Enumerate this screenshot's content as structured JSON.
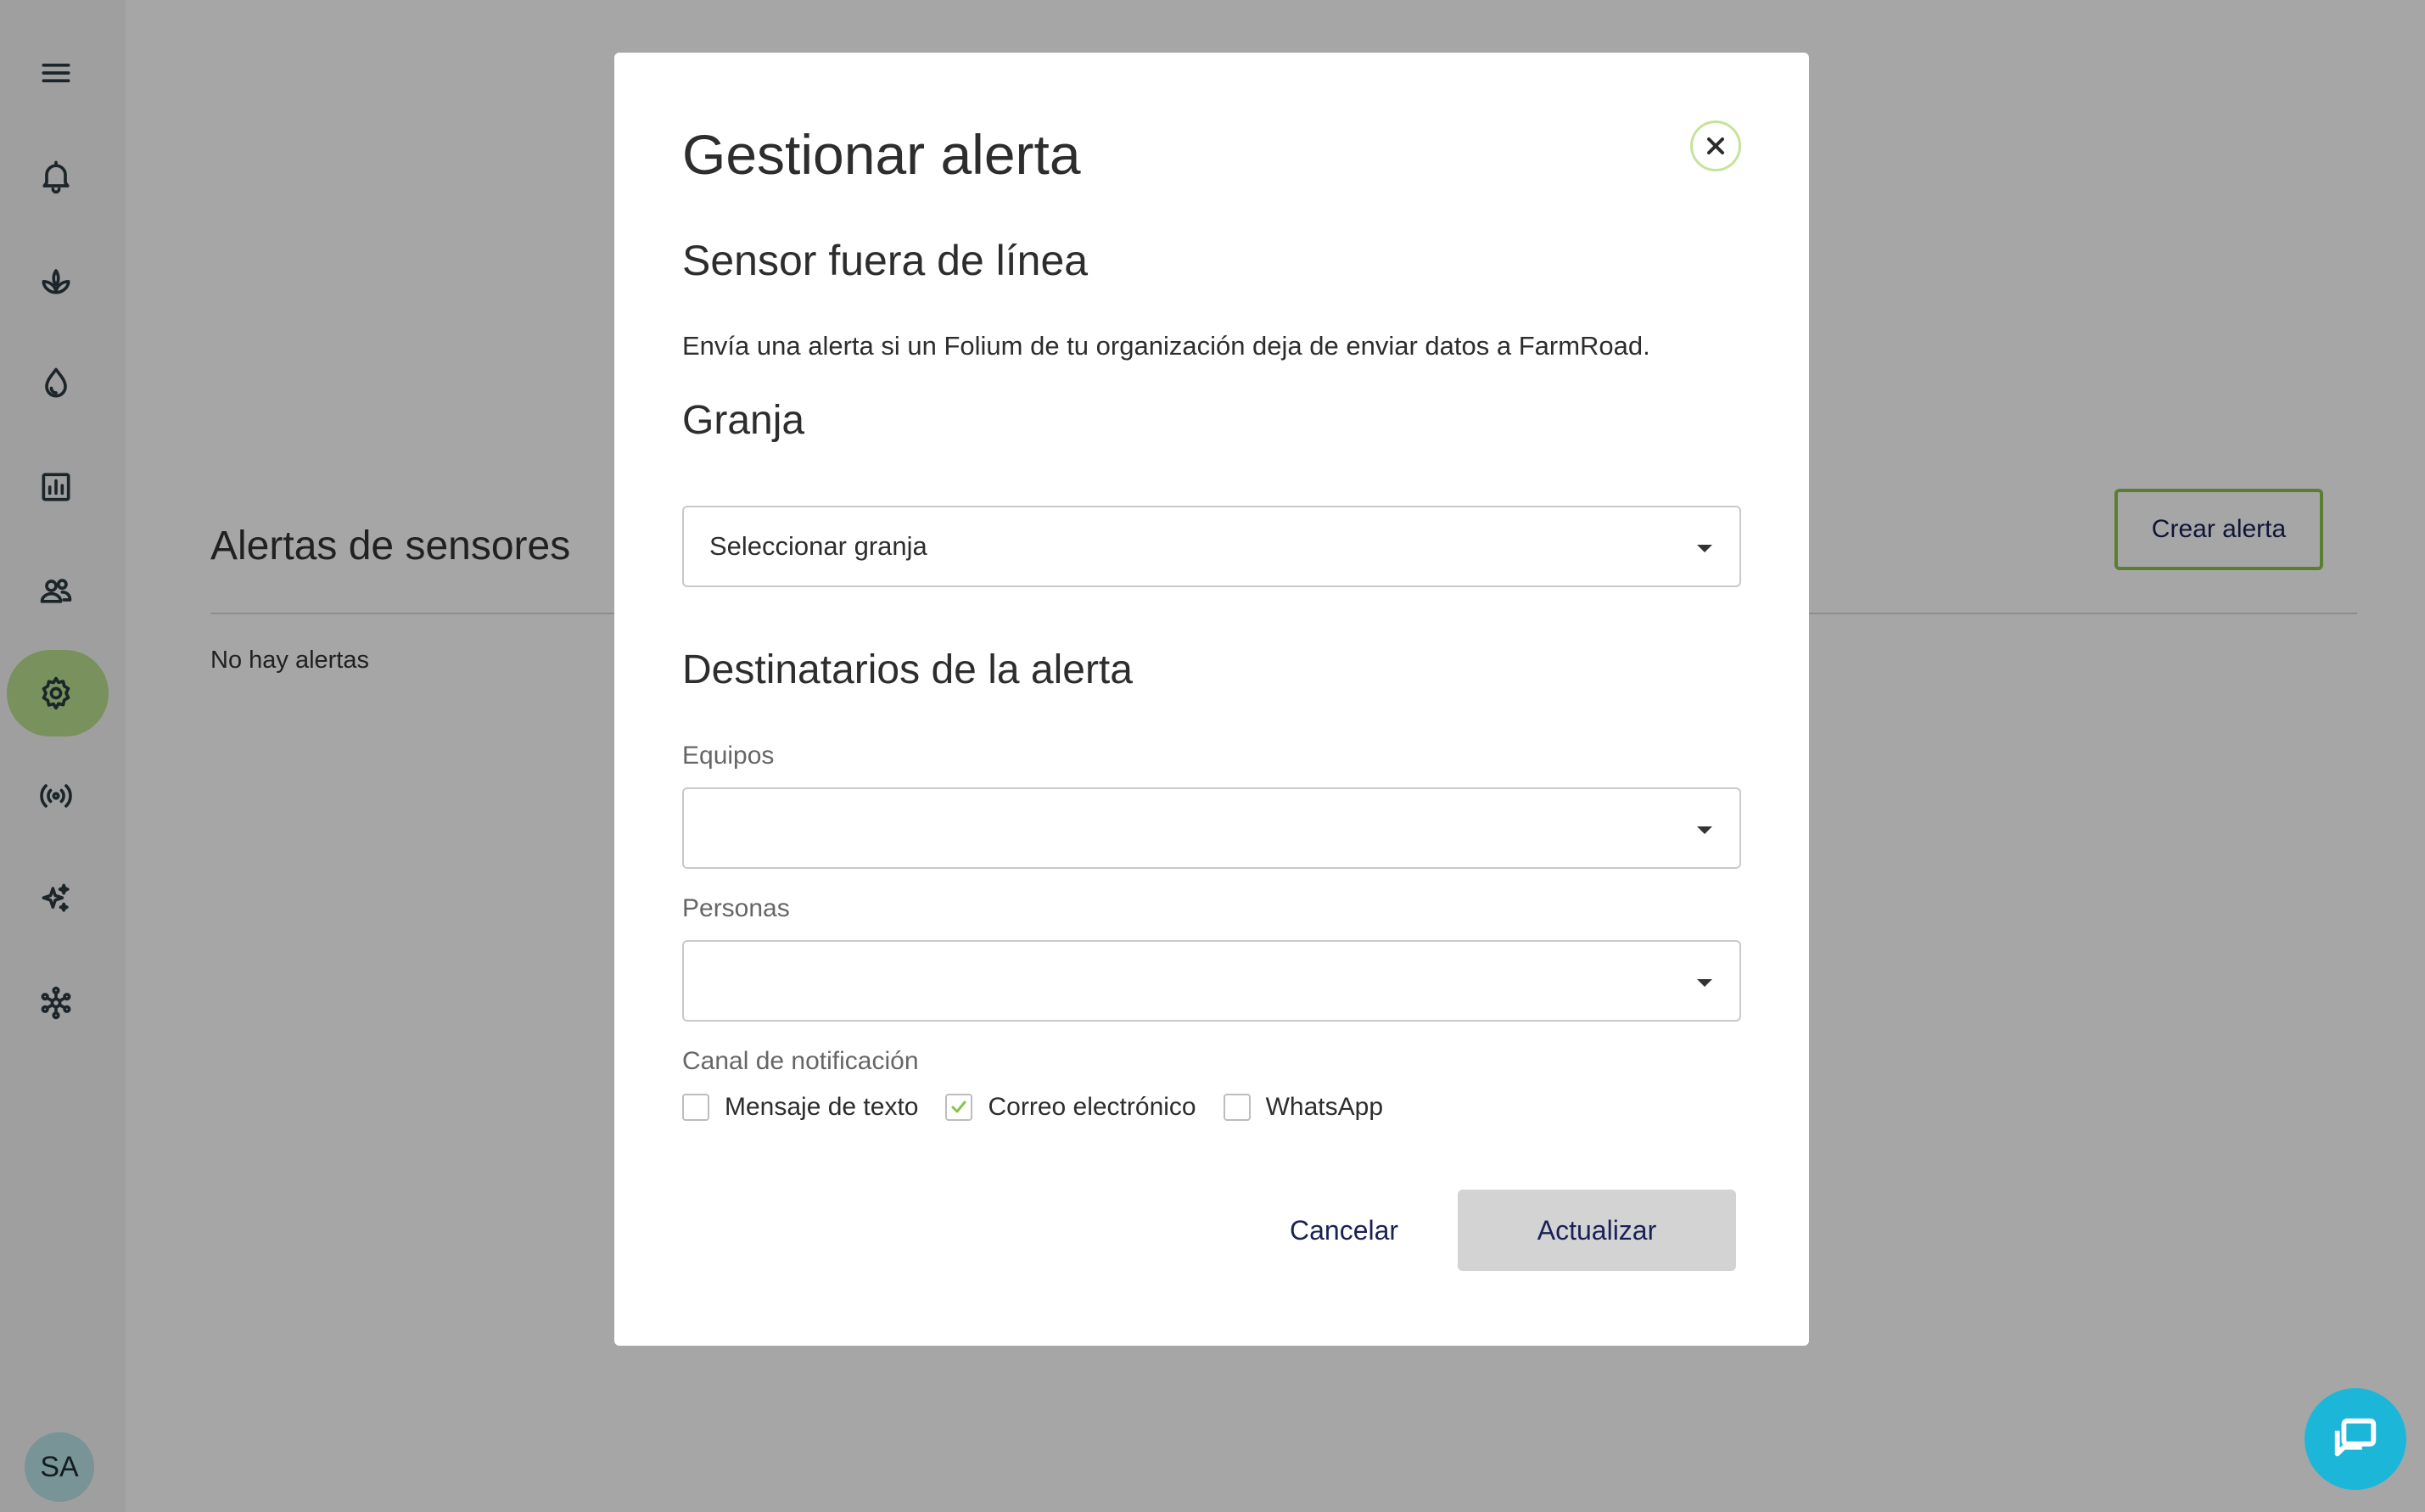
{
  "sidebar": {
    "items": [
      {
        "name": "menu-icon"
      },
      {
        "name": "bell-icon"
      },
      {
        "name": "plant-icon"
      },
      {
        "name": "water-drop-icon"
      },
      {
        "name": "chart-icon"
      },
      {
        "name": "people-icon"
      },
      {
        "name": "gear-icon",
        "active": true
      },
      {
        "name": "broadcast-icon"
      },
      {
        "name": "sparkle-icon"
      },
      {
        "name": "network-icon"
      }
    ],
    "avatar_initials": "SA",
    "active_color": "#b8df8f"
  },
  "main": {
    "title": "Alertas de sensores",
    "empty_text": "No hay alertas",
    "create_button": "Crear alerta"
  },
  "modal": {
    "title": "Gestionar alerta",
    "subtitle": "Sensor fuera de línea",
    "description": "Envía una alerta si un Folium de tu organización deja de enviar datos a FarmRoad.",
    "farm_heading": "Granja",
    "farm_select_value": "Seleccionar granja",
    "recipients_heading": "Destinatarios de la alerta",
    "teams_label": "Equipos",
    "teams_value": "",
    "people_label": "Personas",
    "people_value": "",
    "channel_label": "Canal de notificación",
    "channels": [
      {
        "label": "Mensaje de texto",
        "checked": false
      },
      {
        "label": "Correo electrónico",
        "checked": true
      },
      {
        "label": "WhatsApp",
        "checked": false
      }
    ],
    "cancel_button": "Cancelar",
    "update_button": "Actualizar"
  },
  "colors": {
    "accent_green": "#8bc34a",
    "chat_blue": "#1cb7d8",
    "button_text": "#1a2156"
  }
}
